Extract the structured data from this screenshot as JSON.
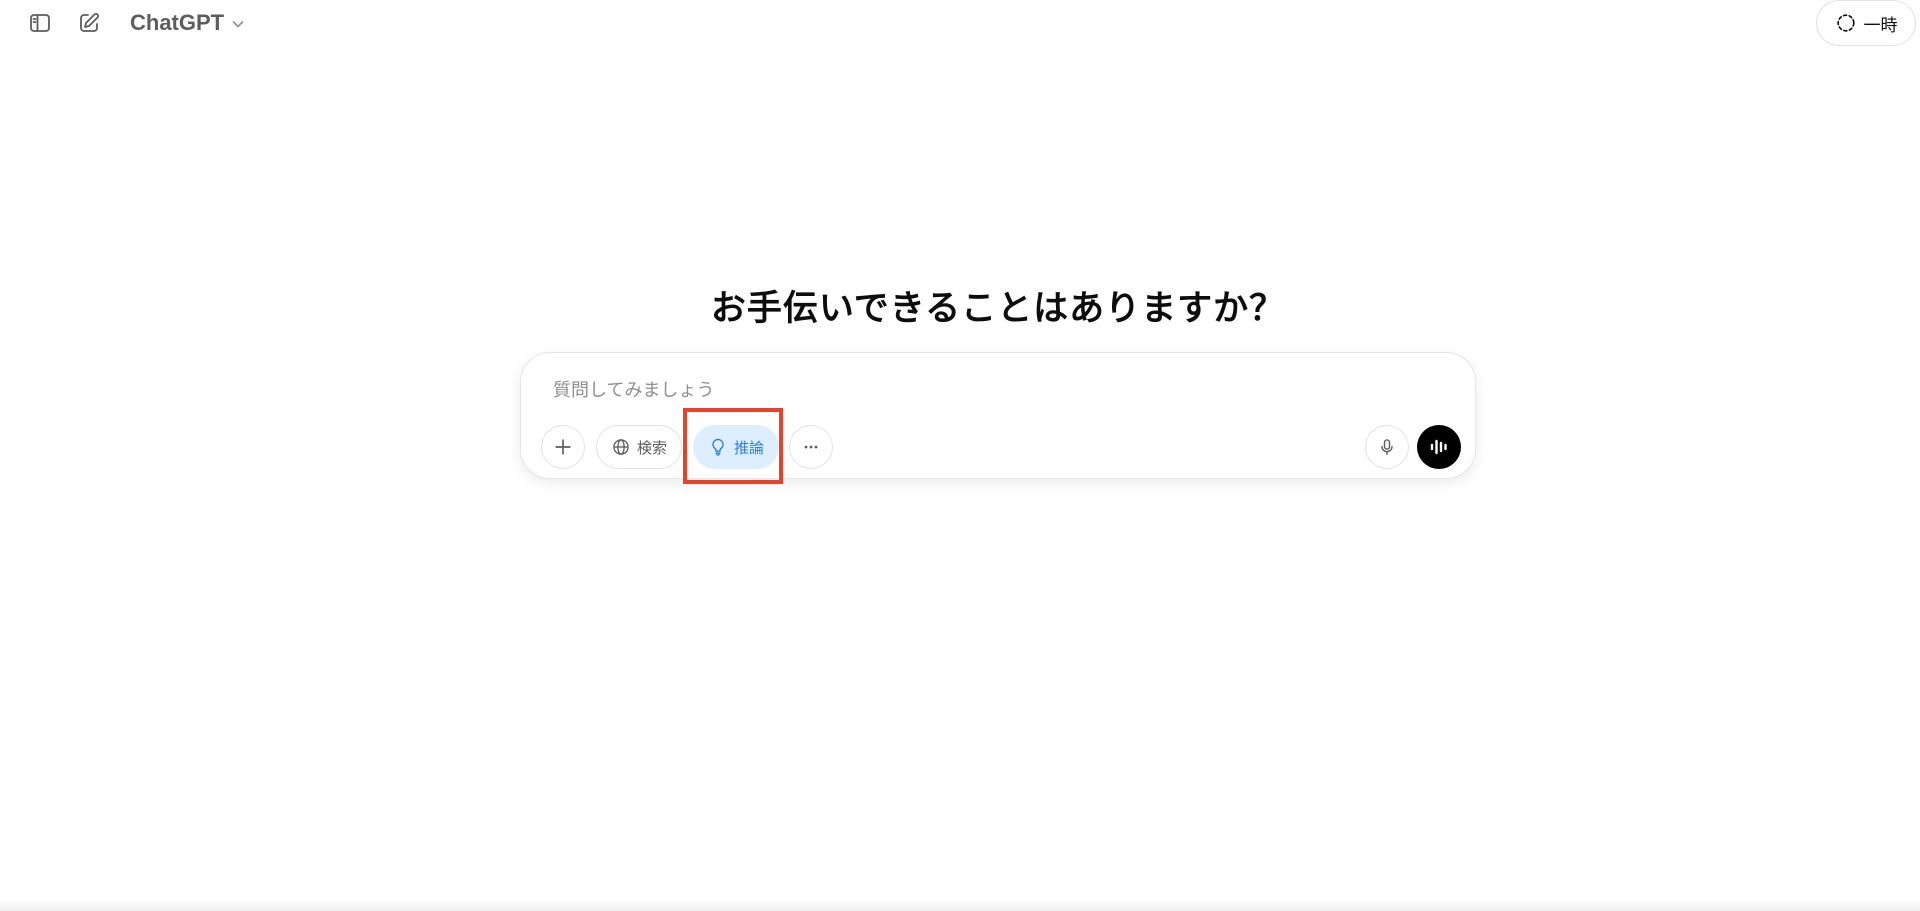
{
  "header": {
    "model_name": "ChatGPT",
    "temporary_label": "一時",
    "icons": {
      "sidebar": "sidebar-toggle-icon",
      "new_chat": "compose-icon",
      "model_dropdown": "chevron-down-icon",
      "temporary": "dashed-circle-icon"
    }
  },
  "main": {
    "heading": "お手伝いできることはありますか？"
  },
  "composer": {
    "placeholder": "質問してみましょう",
    "value": "",
    "tools": {
      "search_label": "検索",
      "reason_label": "推論"
    },
    "icons": {
      "attach": "plus-icon",
      "search": "globe-icon",
      "reason": "lightbulb-icon",
      "more": "more-horizontal-icon",
      "mic": "microphone-icon",
      "voice": "voice-waveform-icon"
    }
  },
  "colors": {
    "reason_active_bg": "#dceeff",
    "reason_active_text": "#2f7fd6",
    "highlight_annotation": "#e8412c",
    "voice_button_bg": "#000000"
  }
}
